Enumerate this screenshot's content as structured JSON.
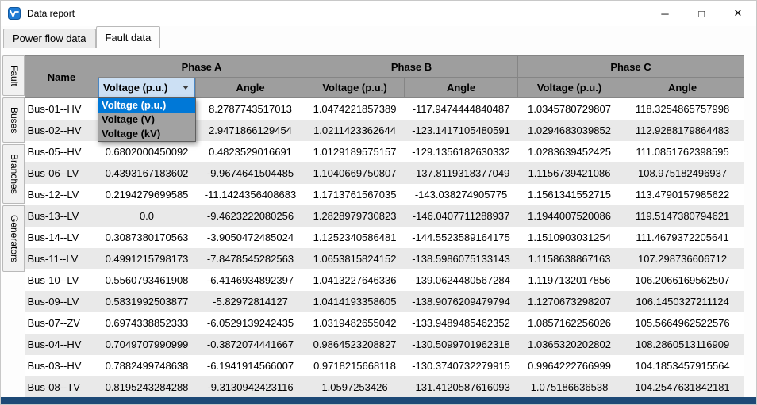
{
  "window": {
    "title": "Data report",
    "controls": {
      "minimize": "─",
      "maximize": "□",
      "close": "✕"
    }
  },
  "tabs": [
    {
      "label": "Power flow data",
      "active": false
    },
    {
      "label": "Fault data",
      "active": true
    }
  ],
  "side_tabs": [
    {
      "label": "Fault"
    },
    {
      "label": "Buses"
    },
    {
      "label": "Branches"
    },
    {
      "label": "Generators"
    }
  ],
  "table": {
    "group_headers": [
      "Name",
      "Phase A",
      "Phase B",
      "Phase C"
    ],
    "sub_headers": [
      "Voltage (p.u.)",
      "Angle",
      "Voltage (p.u.)",
      "Angle",
      "Voltage (p.u.)",
      "Angle"
    ],
    "dropdown": {
      "value": "Voltage (p.u.)",
      "options": [
        "Voltage (p.u.)",
        "Voltage (V)",
        "Voltage (kV)"
      ],
      "selected_index": 0
    },
    "rows": [
      [
        "Bus-01--HV",
        "",
        "8.2787743517013",
        "1.0474221857389",
        "-117.9474444840487",
        "1.0345780729807",
        "118.3254865757998"
      ],
      [
        "Bus-02--HV",
        "",
        "2.9471866129454",
        "1.0211423362644",
        "-123.1417105480591",
        "1.0294683039852",
        "112.9288179864483"
      ],
      [
        "Bus-05--HV",
        "0.6802000450092",
        "0.4823529016691",
        "1.0129189575157",
        "-129.1356182630332",
        "1.0283639452425",
        "111.0851762398595"
      ],
      [
        "Bus-06--LV",
        "0.4393167183602",
        "-9.9674641504485",
        "1.1040669750807",
        "-137.8119318377049",
        "1.1156739421086",
        "108.975182496937"
      ],
      [
        "Bus-12--LV",
        "0.2194279699585",
        "-11.1424356408683",
        "1.1713761567035",
        "-143.038274905775",
        "1.1561341552715",
        "113.4790157985622"
      ],
      [
        "Bus-13--LV",
        "0.0",
        "-9.4623222080256",
        "1.2828979730823",
        "-146.0407711288937",
        "1.1944007520086",
        "119.5147380794621"
      ],
      [
        "Bus-14--LV",
        "0.3087380170563",
        "-3.9050472485024",
        "1.1252340586481",
        "-144.5523589164175",
        "1.1510903031254",
        "111.4679372205641"
      ],
      [
        "Bus-11--LV",
        "0.4991215798173",
        "-7.8478545282563",
        "1.0653815824152",
        "-138.5986075133143",
        "1.1158638867163",
        "107.298736606712"
      ],
      [
        "Bus-10--LV",
        "0.5560793461908",
        "-6.4146934892397",
        "1.0413227646336",
        "-139.0624480567284",
        "1.1197132017856",
        "106.2066169562507"
      ],
      [
        "Bus-09--LV",
        "0.5831992503877",
        "-5.82972814127",
        "1.0414193358605",
        "-138.9076209479794",
        "1.1270673298207",
        "106.1450327211124"
      ],
      [
        "Bus-07--ZV",
        "0.6974338852333",
        "-6.0529139242435",
        "1.0319482655042",
        "-133.9489485462352",
        "1.0857162256026",
        "105.5664962522576"
      ],
      [
        "Bus-04--HV",
        "0.7049707990999",
        "-0.3872074441667",
        "0.9864523208827",
        "-130.5099701962318",
        "1.0365320202802",
        "108.2860513116909"
      ],
      [
        "Bus-03--HV",
        "0.7882499748638",
        "-6.1941914566007",
        "0.9718215668118",
        "-130.3740732279915",
        "0.9964222766999",
        "104.1853457915564"
      ],
      [
        "Bus-08--TV",
        "0.8195243284288",
        "-9.3130942423116",
        "1.0597253426",
        "-131.4120587616093",
        "1.075186636538",
        "104.2547631842181"
      ]
    ]
  },
  "colors": {
    "accent": "#0078d7",
    "header_bg": "#9e9e9e",
    "row_alt": "#e9e9e9",
    "combobox_bg": "#cce0f4",
    "dropdown_bg": "#a2a2a2",
    "taskbar": "#1d4976"
  }
}
